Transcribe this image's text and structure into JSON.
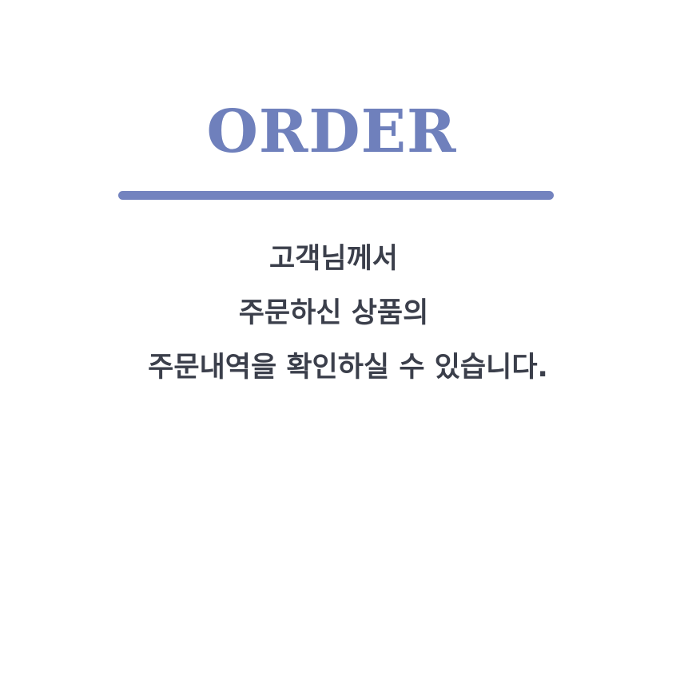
{
  "title": "ORDER",
  "message": {
    "line1": "고객님께서",
    "line2": "주문하신 상품의",
    "line3": "주문내역을 확인하실 수 있습니다."
  },
  "colors": {
    "accent": "#6f80bc",
    "divider": "#7383bf",
    "text": "#3b3f4b",
    "background": "#ffffff"
  }
}
